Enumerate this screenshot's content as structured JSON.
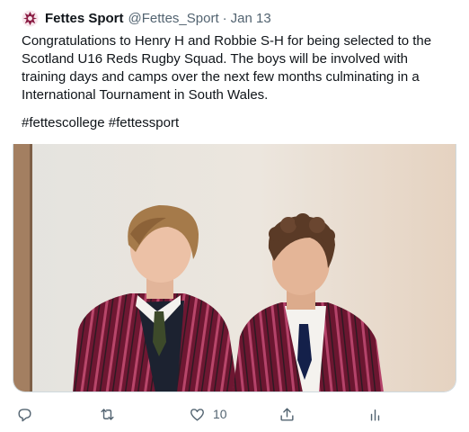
{
  "tweet": {
    "display_name": "Fettes Sport",
    "handle": "@Fettes_Sport",
    "separator": "·",
    "date": "Jan 13",
    "text_lines": [
      "Congratulations to Henry H and Robbie S-H for being selected to the",
      "Scotland U16 Reds Rugby Squad. The boys will be involved with",
      "training days and camps over the next few months culminating in a",
      "International Tournament in South Wales."
    ],
    "hashtags": "#fettescollege #fettessport"
  },
  "actions": {
    "reply_icon": "reply-icon",
    "retweet_icon": "retweet-icon",
    "like_icon": "heart-icon",
    "like_count": "10",
    "share_icon": "share-icon",
    "analytics_icon": "analytics-icon"
  },
  "colors": {
    "text": "#0f1419",
    "secondary": "#536471",
    "blazer": "#7a1d3a",
    "stripe": "#c04a6a"
  }
}
